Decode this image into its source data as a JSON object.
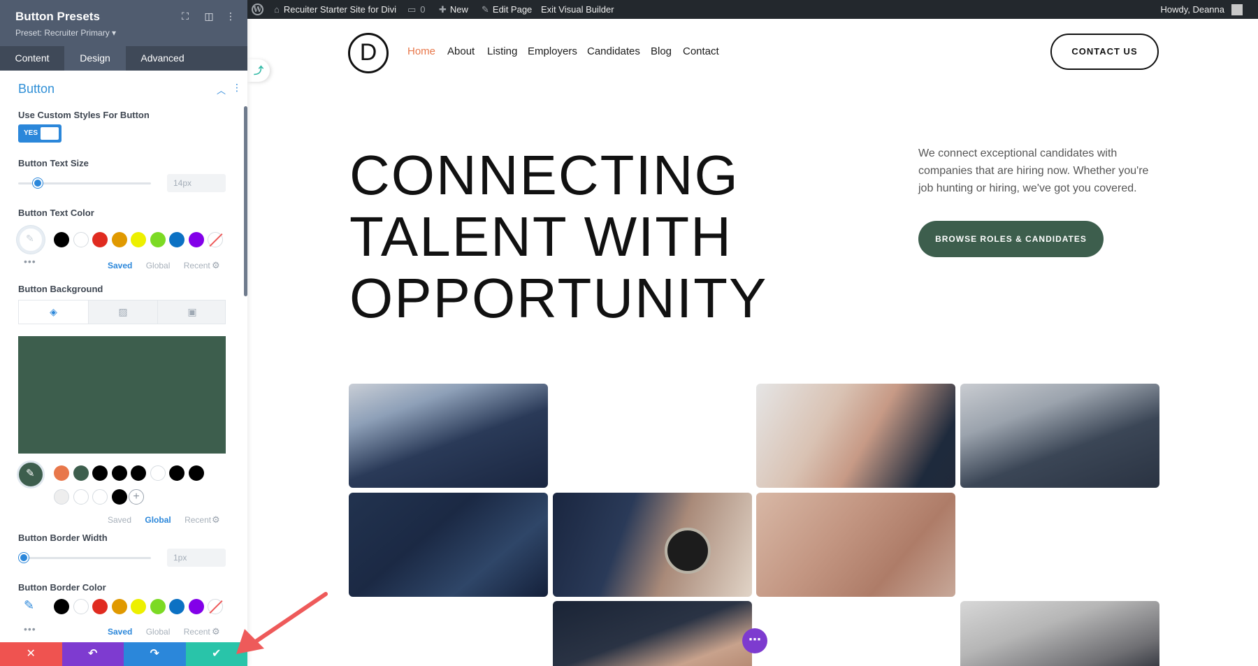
{
  "panel": {
    "title": "Button Presets",
    "preset_label": "Preset: Recruiter Primary ▾",
    "tabs": [
      "Content",
      "Design",
      "Advanced"
    ],
    "section_title": "Button",
    "use_custom_label": "Use Custom Styles For Button",
    "toggle_value": "YES",
    "text_size_label": "Button Text Size",
    "text_size_value": "14px",
    "text_color_label": "Button Text Color",
    "background_label": "Button Background",
    "border_width_label": "Button Border Width",
    "border_width_value": "1px",
    "border_color_label": "Button Border Color",
    "library_tabs": [
      "Saved",
      "Global",
      "Recent"
    ],
    "text_color_active_tab": "Saved",
    "background_active_tab": "Global",
    "colors": {
      "palette": [
        "#000000",
        "#ffffff",
        "#e02b20",
        "#e09900",
        "#edf000",
        "#7cda24",
        "#0c71c3",
        "#8300e9"
      ],
      "background_preview": "#3d5e4d",
      "accent": "#2b87da",
      "global_row1": [
        "#e8774a",
        "#3d5e4d",
        "#000000",
        "#000000",
        "#000000",
        "#ffffff",
        "#000000",
        "#000000"
      ],
      "global_row2": [
        "#eeeeee",
        "#ffffff",
        "#ffffff",
        "#000000"
      ]
    }
  },
  "actions": {
    "colors": [
      "#ef5350",
      "#7e3bd0",
      "#2b87da",
      "#29c4a9"
    ],
    "icons": [
      "close-icon",
      "undo-icon",
      "redo-icon",
      "check-icon"
    ]
  },
  "adminbar": {
    "site_name": "Recuiter Starter Site for Divi",
    "comments_count": "0",
    "new_label": "New",
    "edit_label": "Edit Page",
    "exit_label": "Exit Visual Builder",
    "greeting": "Howdy, Deanna"
  },
  "site": {
    "logo_letter": "D",
    "nav": [
      "Home",
      "About",
      "Listing",
      "Employers",
      "Candidates",
      "Blog",
      "Contact"
    ],
    "contact_button": "CONTACT US",
    "hero_title_lines": [
      "CONNECTING",
      "TALENT WITH",
      "OPPORTUNITY"
    ],
    "hero_description": "We connect exceptional candidates with companies that are hiring now. Whether you're job hunting or hiring, we've got you covered.",
    "cta_button": "BROWSE ROLES & CANDIDATES"
  }
}
